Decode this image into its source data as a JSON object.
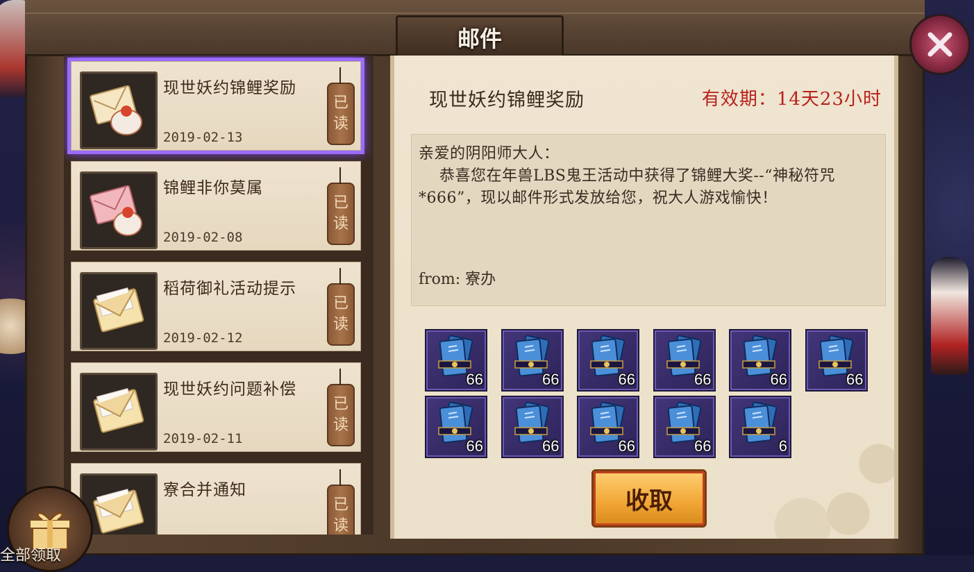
{
  "window": {
    "title": "邮件"
  },
  "mails": [
    {
      "title": "现世妖约锦鲤奖励",
      "date": "2019-02-13",
      "status": [
        "已",
        "读"
      ],
      "icon": "envelope-gift-icon",
      "selected": true
    },
    {
      "title": "锦鲤非你莫属",
      "date": "2019-02-08",
      "status": [
        "已",
        "读"
      ],
      "icon": "pink-envelope-gift-icon",
      "selected": false
    },
    {
      "title": "稻荷御礼活动提示",
      "date": "2019-02-12",
      "status": [
        "已",
        "读"
      ],
      "icon": "envelope-icon",
      "selected": false
    },
    {
      "title": "现世妖约问题补偿",
      "date": "2019-02-11",
      "status": [
        "已",
        "读"
      ],
      "icon": "envelope-icon",
      "selected": false
    },
    {
      "title": "寮合并通知",
      "date": "",
      "status": [
        "已",
        "读"
      ],
      "icon": "envelope-icon",
      "selected": false
    }
  ],
  "detail": {
    "title": "现世妖约锦鲤奖励",
    "validity": "有效期：14天23小时",
    "body": "亲爱的阴阳师大人：\n    恭喜您在年兽LBS鬼王活动中获得了锦鲤大奖--“神秘符咒*666”，现以邮件形式发放给您，祝大人游戏愉快！",
    "from": "from: 寮办"
  },
  "rewards": [
    "66",
    "66",
    "66",
    "66",
    "66",
    "66",
    "66",
    "66",
    "66",
    "66",
    "6"
  ],
  "claim_button": "收取",
  "claim_all": "全部领取",
  "colors": {
    "accent_red": "#b8211c",
    "select_glow": "#9b6cff",
    "button_gold": "#f0a534"
  }
}
